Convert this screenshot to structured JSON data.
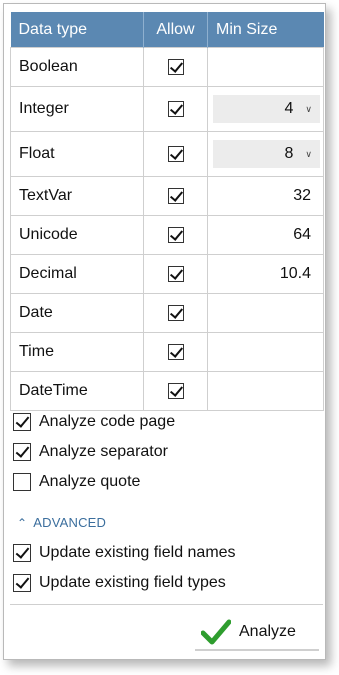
{
  "grid": {
    "headers": {
      "data_type": "Data type",
      "allow": "Allow",
      "min_size": "Min Size"
    },
    "rows": [
      {
        "name": "Boolean",
        "allow": true,
        "min_size": "",
        "control": "text"
      },
      {
        "name": "Integer",
        "allow": true,
        "min_size": "4",
        "control": "dropdown"
      },
      {
        "name": "Float",
        "allow": true,
        "min_size": "8",
        "control": "dropdown"
      },
      {
        "name": "TextVar",
        "allow": true,
        "min_size": "32",
        "control": "text"
      },
      {
        "name": "Unicode",
        "allow": true,
        "min_size": "64",
        "control": "text"
      },
      {
        "name": "Decimal",
        "allow": true,
        "min_size": "10.4",
        "control": "text"
      },
      {
        "name": "Date",
        "allow": true,
        "min_size": "",
        "control": "text"
      },
      {
        "name": "Time",
        "allow": true,
        "min_size": "",
        "control": "text"
      },
      {
        "name": "DateTime",
        "allow": true,
        "min_size": "",
        "control": "text"
      }
    ]
  },
  "options": {
    "analyze_code_page": {
      "label": "Analyze code page",
      "checked": true
    },
    "analyze_separator": {
      "label": "Analyze separator",
      "checked": true
    },
    "analyze_quote": {
      "label": "Analyze quote",
      "checked": false
    }
  },
  "advanced": {
    "label": "ADVANCED",
    "update_field_names": {
      "label": "Update existing field names",
      "checked": true
    },
    "update_field_types": {
      "label": "Update existing field types",
      "checked": true
    }
  },
  "actions": {
    "analyze_label": "Analyze"
  },
  "colors": {
    "header_bg": "#5b88b2",
    "accent": "#3b6e9d",
    "check_green": "#2e9d2e"
  }
}
